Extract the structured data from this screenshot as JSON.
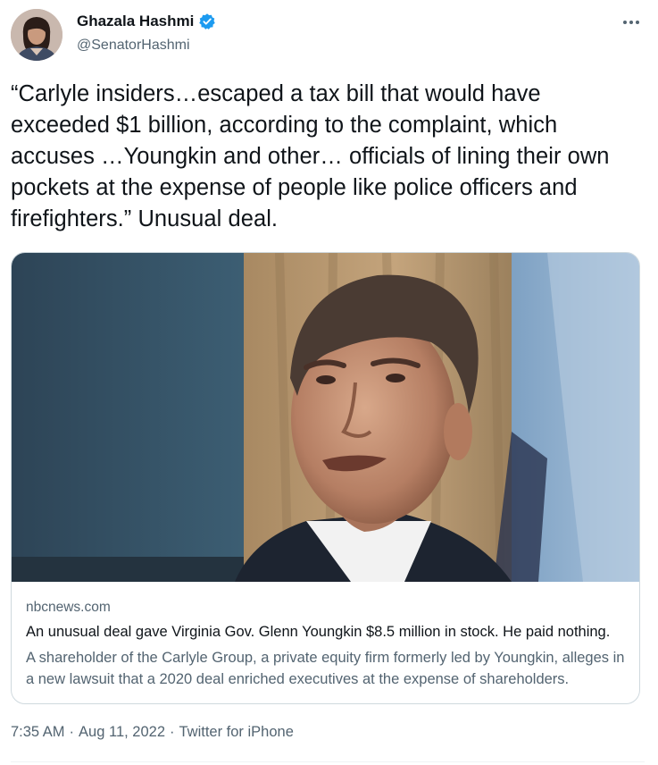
{
  "author": {
    "display_name": "Ghazala Hashmi",
    "handle": "@SenatorHashmi",
    "verified": true,
    "verified_color": "#1d9bf0"
  },
  "tweet": {
    "text": "“Carlyle insiders…escaped a tax bill that would have exceeded $1 billion, according to the complaint, which accuses …Youngkin and other… officials of lining their own pockets at the expense of people like police officers and firefighters.” Unusual deal."
  },
  "card": {
    "domain": "nbcnews.com",
    "title": "An unusual deal gave Virginia Gov. Glenn Youngkin $8.5 million in stock. He paid nothing.",
    "description": "A shareholder of the Carlyle Group, a private equity firm formerly led by Youngkin, alleges in a new lawsuit that a 2020 deal enriched executives at the expense of shareholders."
  },
  "meta": {
    "time": "7:35 AM",
    "date": "Aug 11, 2022",
    "source": "Twitter for iPhone",
    "separator": "·"
  },
  "colors": {
    "text_primary": "#0f1419",
    "text_secondary": "#536471",
    "border": "#cfd9de"
  },
  "icons": {
    "more": "more-horizontal-icon",
    "verified": "verified-badge-icon"
  }
}
